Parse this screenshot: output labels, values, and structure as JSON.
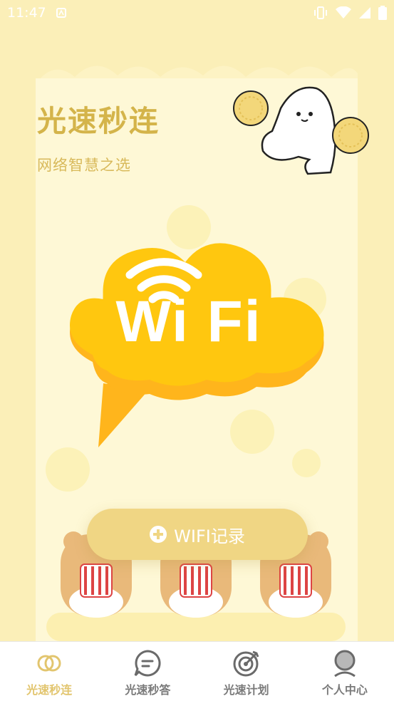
{
  "status_bar": {
    "time": "11:47",
    "icons": [
      "notification-a-icon",
      "vibrate-icon",
      "wifi-signal-icon",
      "cell-signal-icon",
      "battery-icon"
    ]
  },
  "header": {
    "title": "光速秒连",
    "subtitle": "网络智慧之选"
  },
  "hero": {
    "wifi_label": "Wi Fi"
  },
  "action": {
    "record_button_label": "WIFI记录"
  },
  "bottom_nav": {
    "items": [
      {
        "label": "光速秒连",
        "icon": "rings-icon",
        "active": true
      },
      {
        "label": "光速秒答",
        "icon": "chat-bubble-icon",
        "active": false
      },
      {
        "label": "光速计划",
        "icon": "target-icon",
        "active": false
      },
      {
        "label": "个人中心",
        "icon": "user-icon",
        "active": false
      }
    ]
  },
  "colors": {
    "background": "#fbefb8",
    "accent": "#d4b44a",
    "wifi_yellow": "#ffc20e",
    "button": "#f0d684",
    "nav_active": "#e2c56e",
    "nav_inactive": "#7a7a7a"
  }
}
